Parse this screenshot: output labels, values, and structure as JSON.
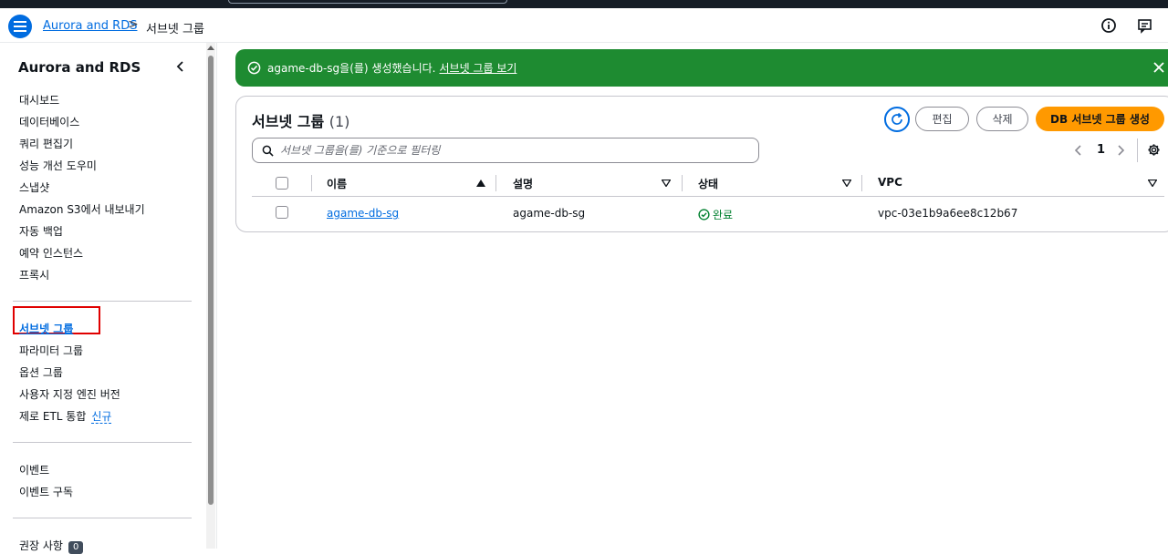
{
  "header": {
    "breadcrumb_root": "Aurora and RDS",
    "breadcrumb_separator": ">",
    "breadcrumb_current": "서브넷 그룹"
  },
  "sidebar": {
    "title": "Aurora and RDS",
    "group1": [
      "대시보드",
      "데이터베이스",
      "쿼리 편집기",
      "성능 개선 도우미",
      "스냅샷",
      "Amazon S3에서 내보내기",
      "자동 백업",
      "예약 인스턴스",
      "프록시"
    ],
    "group2": [
      "서브넷 그룹",
      "파라미터 그룹",
      "옵션 그룹",
      "사용자 지정 엔진 버전",
      "제로 ETL 통합"
    ],
    "new_badge": "신규",
    "group3": [
      "이벤트",
      "이벤트 구독"
    ],
    "recommendations": "권장 사항",
    "recommendations_count": "0"
  },
  "flash": {
    "message": "agame-db-sg을(를) 생성했습니다.",
    "link": "서브넷 그룹 보기",
    "color": "#1e8b31"
  },
  "panel": {
    "title": "서브넷 그룹",
    "count": "(1)",
    "edit_label": "편집",
    "delete_label": "삭제",
    "create_label": "DB 서브넷 그룹 생성",
    "search_placeholder": "서브넷 그룹을(를) 기준으로 필터링",
    "current_page": "1",
    "columns": [
      "이름",
      "설명",
      "상태",
      "VPC"
    ],
    "rows": [
      {
        "name": "agame-db-sg",
        "description": "agame-db-sg",
        "status": "완료",
        "vpc": "vpc-03e1b9a6ee8c12b67"
      }
    ]
  },
  "colors": {
    "accent": "#006ce0",
    "primary_button": "#ff9900",
    "success": "#00802f"
  }
}
